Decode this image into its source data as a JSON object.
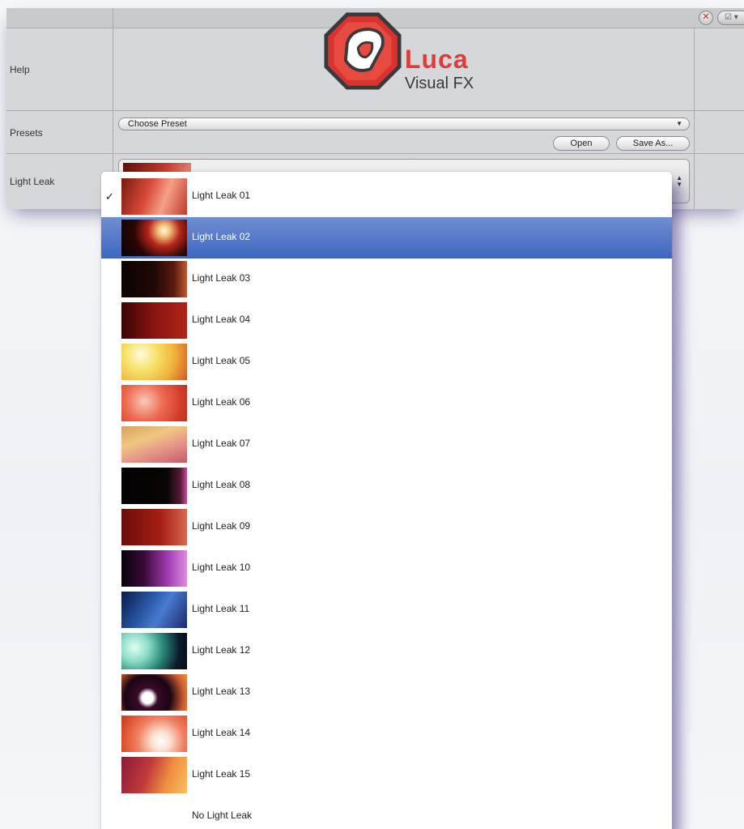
{
  "panel": {
    "rows": {
      "help": "Help",
      "presets": "Presets",
      "light_leak": "Light Leak"
    },
    "header": {
      "close_glyph": "✕",
      "menu_glyph": "☑ ▾"
    },
    "logo": {
      "brand": "Luca",
      "subtitle": "Visual FX",
      "brand_color": "#e13a37"
    },
    "presets": {
      "select_value": "Choose Preset",
      "open_label": "Open",
      "save_label": "Save As..."
    },
    "light_leak": {
      "selected_value": "Light Leak 02"
    }
  },
  "menu": {
    "selected_index": 1,
    "checked_index": 0,
    "items": [
      {
        "label": "Light Leak 01"
      },
      {
        "label": "Light Leak 02"
      },
      {
        "label": "Light Leak 03"
      },
      {
        "label": "Light Leak 04"
      },
      {
        "label": "Light Leak 05"
      },
      {
        "label": "Light Leak 06"
      },
      {
        "label": "Light Leak 07"
      },
      {
        "label": "Light Leak 08"
      },
      {
        "label": "Light Leak 09"
      },
      {
        "label": "Light Leak 10"
      },
      {
        "label": "Light Leak 11"
      },
      {
        "label": "Light Leak 12"
      },
      {
        "label": "Light Leak 13"
      },
      {
        "label": "Light Leak 14"
      },
      {
        "label": "Light Leak 15"
      },
      {
        "label": "No Light Leak"
      }
    ]
  },
  "colors": {
    "selection": "#4a70c6"
  }
}
